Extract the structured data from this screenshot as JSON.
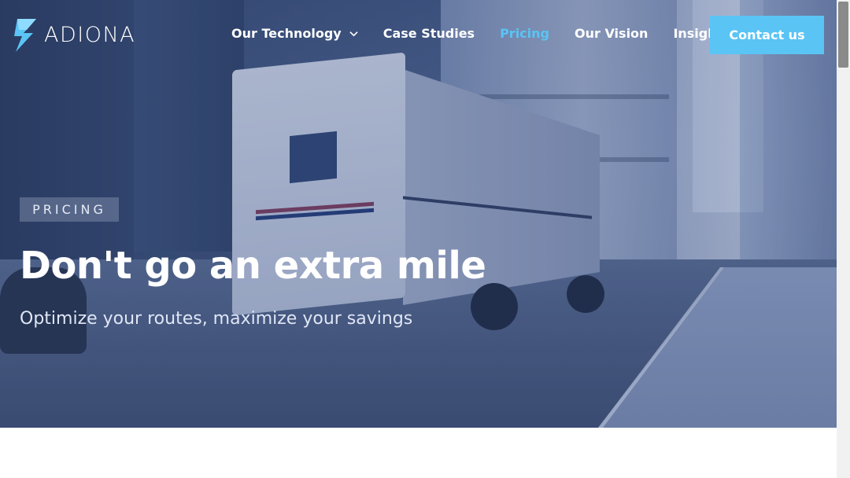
{
  "brand": {
    "name": "ADIONA",
    "accent": "#5ac4f5"
  },
  "nav": {
    "items": [
      {
        "label": "Our Technology",
        "has_dropdown": true,
        "active": false
      },
      {
        "label": "Case Studies",
        "has_dropdown": false,
        "active": false
      },
      {
        "label": "Pricing",
        "has_dropdown": false,
        "active": true
      },
      {
        "label": "Our Vision",
        "has_dropdown": false,
        "active": false
      },
      {
        "label": "Insights",
        "has_dropdown": true,
        "active": false
      }
    ],
    "cta_label": "Contact us"
  },
  "hero": {
    "tag": "PRICING",
    "headline": "Don't go an extra mile",
    "subheadline": "Optimize your routes, maximize your savings",
    "background_image": "city-street-delivery-truck"
  },
  "icons": {
    "logo": "adiona-logo-icon",
    "dropdown": "chevron-down-icon"
  }
}
